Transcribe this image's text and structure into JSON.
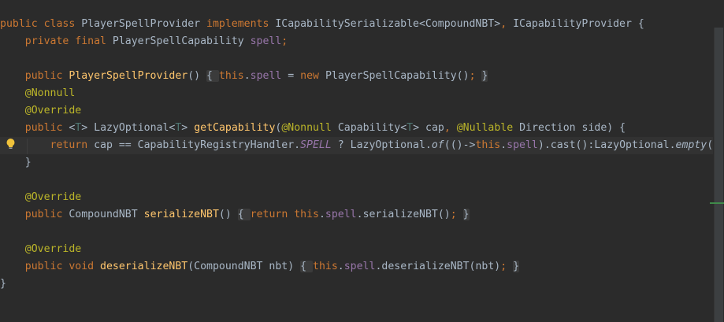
{
  "editor": {
    "colors": {
      "background": "#2b2b2b",
      "current_line": "#323232",
      "keyword": "#cc7832",
      "annotation": "#bbb529",
      "field": "#9876aa",
      "method_declaration": "#ffc66d",
      "type_parameter": "#507874",
      "default_text": "#a9b7c6"
    },
    "lines": [
      [
        {
          "t": "public class ",
          "c": "kw"
        },
        {
          "t": "PlayerSpellProvider ",
          "c": ""
        },
        {
          "t": "implements ",
          "c": "kw"
        },
        {
          "t": "ICapabilitySerializable<CompoundNBT>",
          "c": ""
        },
        {
          "t": ", ",
          "c": "kw"
        },
        {
          "t": "ICapabilityProvider {",
          "c": ""
        }
      ],
      [
        {
          "t": "    private final ",
          "c": "kw"
        },
        {
          "t": "PlayerSpellCapability ",
          "c": ""
        },
        {
          "t": "spell",
          "c": "fld"
        },
        {
          "t": ";",
          "c": "kw"
        }
      ],
      [],
      [
        {
          "t": "    public ",
          "c": "kw"
        },
        {
          "t": "PlayerSpellProvider",
          "c": "fn"
        },
        {
          "t": "() ",
          "c": ""
        },
        {
          "t": "{ ",
          "c": "fold"
        },
        {
          "t": "this",
          "c": "kw"
        },
        {
          "t": ".",
          "c": ""
        },
        {
          "t": "spell",
          "c": "fld"
        },
        {
          "t": " = ",
          "c": ""
        },
        {
          "t": "new ",
          "c": "kw"
        },
        {
          "t": "PlayerSpellCapability()",
          "c": ""
        },
        {
          "t": ";",
          "c": "kw"
        },
        {
          "t": " ",
          "c": ""
        },
        {
          "t": "}",
          "c": "fold"
        }
      ],
      [
        {
          "t": "    @Nonnull",
          "c": "ann"
        }
      ],
      [
        {
          "t": "    @Override",
          "c": "ann"
        }
      ],
      [
        {
          "t": "    public ",
          "c": "kw"
        },
        {
          "t": "<",
          "c": ""
        },
        {
          "t": "T",
          "c": "tp"
        },
        {
          "t": "> LazyOptional<",
          "c": ""
        },
        {
          "t": "T",
          "c": "tp"
        },
        {
          "t": "> ",
          "c": ""
        },
        {
          "t": "getCapability",
          "c": "fn"
        },
        {
          "t": "(",
          "c": ""
        },
        {
          "t": "@Nonnull ",
          "c": "ann"
        },
        {
          "t": "Capability<",
          "c": ""
        },
        {
          "t": "T",
          "c": "tp"
        },
        {
          "t": "> cap",
          "c": ""
        },
        {
          "t": ", ",
          "c": "kw"
        },
        {
          "t": "@Nullable ",
          "c": "ann"
        },
        {
          "t": "Direction side) {",
          "c": ""
        }
      ],
      [
        {
          "t": "        return ",
          "c": "kw"
        },
        {
          "t": "cap == CapabilityRegistryHandler.",
          "c": ""
        },
        {
          "t": "SPELL",
          "c": "sfld"
        },
        {
          "t": " ? LazyOptional.",
          "c": ""
        },
        {
          "t": "of",
          "c": "it"
        },
        {
          "t": "(()->",
          "c": ""
        },
        {
          "t": "this",
          "c": "kw"
        },
        {
          "t": ".",
          "c": ""
        },
        {
          "t": "spell",
          "c": "fld"
        },
        {
          "t": ").cast():LazyOptional.",
          "c": ""
        },
        {
          "t": "empty",
          "c": "it"
        },
        {
          "t": "()",
          "c": ""
        }
      ],
      [
        {
          "t": "    }",
          "c": ""
        }
      ],
      [],
      [
        {
          "t": "    @Override",
          "c": "ann"
        }
      ],
      [
        {
          "t": "    public ",
          "c": "kw"
        },
        {
          "t": "CompoundNBT ",
          "c": ""
        },
        {
          "t": "serializeNBT",
          "c": "fn"
        },
        {
          "t": "() ",
          "c": ""
        },
        {
          "t": "{ ",
          "c": "fold"
        },
        {
          "t": "return this",
          "c": "kw"
        },
        {
          "t": ".",
          "c": ""
        },
        {
          "t": "spell",
          "c": "fld"
        },
        {
          "t": ".serializeNBT()",
          "c": ""
        },
        {
          "t": ";",
          "c": "kw"
        },
        {
          "t": " ",
          "c": ""
        },
        {
          "t": "}",
          "c": "fold"
        }
      ],
      [],
      [
        {
          "t": "    @Override",
          "c": "ann"
        }
      ],
      [
        {
          "t": "    public void ",
          "c": "kw"
        },
        {
          "t": "deserializeNBT",
          "c": "fn"
        },
        {
          "t": "(CompoundNBT nbt) ",
          "c": ""
        },
        {
          "t": "{ ",
          "c": "fold"
        },
        {
          "t": "this",
          "c": "kw"
        },
        {
          "t": ".",
          "c": ""
        },
        {
          "t": "spell",
          "c": "fld"
        },
        {
          "t": ".deserializeNBT(nbt)",
          "c": ""
        },
        {
          "t": ";",
          "c": "kw"
        },
        {
          "t": " ",
          "c": ""
        },
        {
          "t": "}",
          "c": "fold"
        }
      ],
      [
        {
          "t": "}",
          "c": ""
        }
      ]
    ],
    "current_line_index": 7,
    "gutter_icon": "lightbulb-icon"
  }
}
